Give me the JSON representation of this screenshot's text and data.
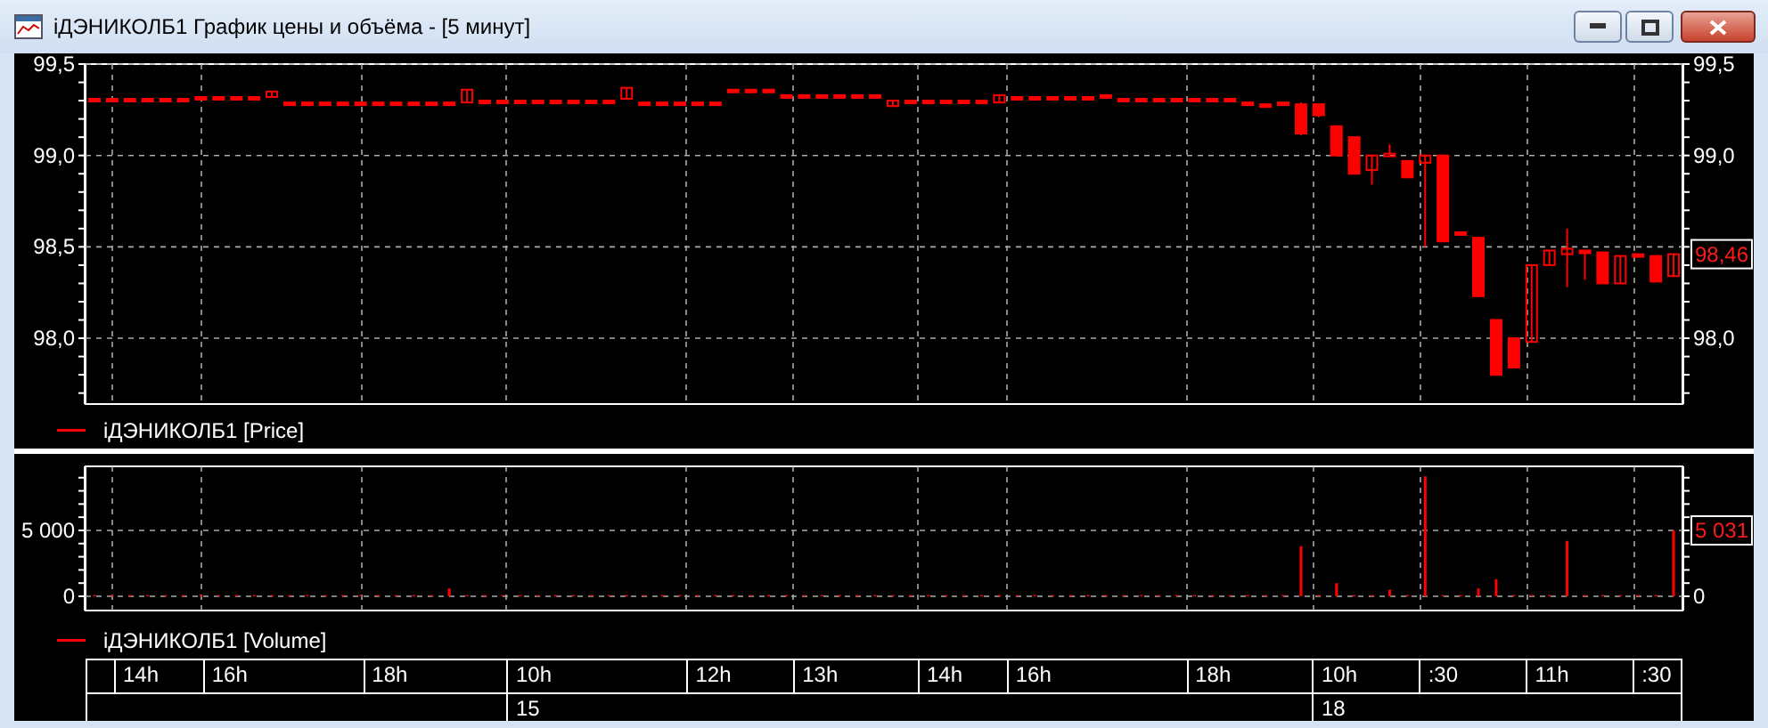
{
  "window": {
    "title": "iДЭНИКОЛБ1 График цены и объёма - [5 минут]"
  },
  "price_panel": {
    "legend": "iДЭНИКОЛБ1 [Price]",
    "last_value": "98,46",
    "left_axis_labels": [
      "99,5",
      "99,0",
      "98,5",
      "98,0"
    ],
    "right_axis_labels": [
      "99,5",
      "99,0",
      "98,0"
    ]
  },
  "volume_panel": {
    "last_value": "5 031",
    "chart_data": {
      "type": "bar",
      "grid": true,
      "ylim": [
        -1080,
        9860
      ],
      "yticks": [
        {
          "value": 0,
          "label": "0"
        },
        {
          "value": 5000,
          "label": "5 000"
        }
      ],
      "series": [
        {
          "name": "iДЭНИКОЛБ1 [Volume]",
          "color": "#ff0000",
          "values": [
            100,
            100,
            100,
            100,
            100,
            100,
            100,
            100,
            100,
            100,
            100,
            100,
            100,
            100,
            100,
            100,
            100,
            100,
            100,
            100,
            600,
            100,
            100,
            100,
            100,
            100,
            100,
            100,
            100,
            100,
            100,
            100,
            100,
            100,
            100,
            100,
            100,
            100,
            100,
            100,
            100,
            100,
            100,
            100,
            100,
            100,
            100,
            100,
            100,
            100,
            100,
            100,
            100,
            100,
            100,
            100,
            100,
            100,
            100,
            100,
            100,
            100,
            100,
            100,
            100,
            100,
            100,
            100,
            3800,
            100,
            1000,
            100,
            100,
            500,
            100,
            9100,
            100,
            100,
            600,
            1300,
            100,
            100,
            100,
            4200,
            100,
            100,
            100,
            100,
            100,
            5000
          ]
        }
      ]
    }
  },
  "time_axis": {
    "hours": [
      "14h",
      "16h",
      "18h",
      "10h",
      "12h",
      "13h",
      "14h",
      "16h",
      "18h",
      "10h",
      ":30",
      "11h",
      ":30"
    ],
    "dates": [
      "15",
      "18"
    ]
  }
}
